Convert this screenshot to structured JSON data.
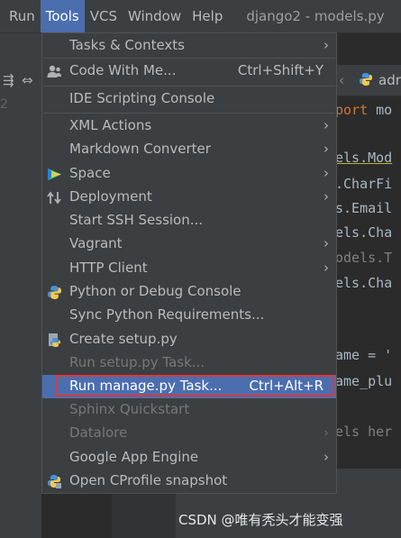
{
  "menubar": {
    "items": [
      "Run",
      "Tools",
      "VCS",
      "Window",
      "Help"
    ],
    "window_title": "django2 - models.py"
  },
  "gutter": {
    "line_number": "2"
  },
  "editor": {
    "tab_label": "adr",
    "lines": [
      {
        "kw": "port",
        "rest": " mo"
      },
      {
        "text": "els.Mod",
        "underline": true
      },
      {
        "text": ".CharFi"
      },
      {
        "text": "s.Email"
      },
      {
        "text": "els.Cha"
      },
      {
        "text": "odels.T",
        "dim": true
      },
      {
        "text": "els.Cha"
      },
      {
        "text": "ame = '",
        "str_tail": true
      },
      {
        "text": "ame_plu"
      },
      {
        "text": "els her",
        "comment": true
      }
    ]
  },
  "menu": {
    "items": [
      {
        "label": "Tasks & Contexts",
        "submenu": true
      },
      {
        "label": "Code With Me...",
        "shortcut": "Ctrl+Shift+Y",
        "icon": "user-icon"
      },
      {
        "label": "IDE Scripting Console"
      },
      {
        "label": "XML Actions",
        "submenu": true
      },
      {
        "label": "Markdown Converter",
        "submenu": true
      },
      {
        "label": "Space",
        "submenu": true,
        "icon": "space-icon"
      },
      {
        "label": "Deployment",
        "submenu": true,
        "icon": "deployment-icon"
      },
      {
        "label": "Start SSH Session..."
      },
      {
        "label": "Vagrant",
        "submenu": true
      },
      {
        "label": "HTTP Client",
        "submenu": true
      },
      {
        "label": "Python or Debug Console",
        "icon": "python-icon"
      },
      {
        "label": "Sync Python Requirements..."
      },
      {
        "label": "Create setup.py",
        "icon": "setup-py-icon"
      },
      {
        "label": "Run setup.py Task...",
        "disabled": true
      },
      {
        "label": "Run manage.py Task...",
        "shortcut": "Ctrl+Alt+R",
        "highlighted": true
      },
      {
        "label": "Sphinx Quickstart",
        "disabled": true
      },
      {
        "label": "Datalore",
        "submenu": true,
        "disabled": true
      },
      {
        "label": "Google App Engine",
        "submenu": true
      },
      {
        "label": "Open CProfile snapshot",
        "icon": "cprofile-icon"
      }
    ]
  },
  "watermark": "CSDN @唯有秃头才能变强",
  "colors": {
    "menu_bg": "#3c3f41",
    "highlight": "#4b6eaf",
    "callout_border": "#e8343a",
    "editor_bg": "#2b2b2b"
  }
}
